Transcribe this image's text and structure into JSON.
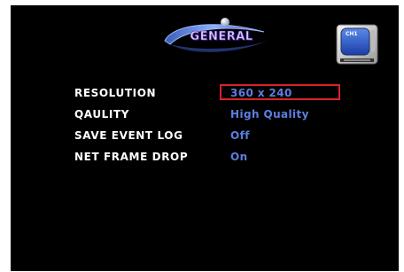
{
  "header": {
    "title": "GENERAL",
    "camera_icon_label": "CH1"
  },
  "colors": {
    "background": "#000000",
    "label_text": "#ffffff",
    "value_text": "#5c7ee0",
    "selection_border": "#d8222a"
  },
  "settings": [
    {
      "label": "RESOLUTION",
      "value": "360 x 240",
      "selected": true
    },
    {
      "label": "QAULITY",
      "value": "High Quality",
      "selected": false
    },
    {
      "label": "SAVE EVENT LOG",
      "value": "Off",
      "selected": false
    },
    {
      "label": "NET FRAME DROP",
      "value": "On",
      "selected": false
    }
  ]
}
